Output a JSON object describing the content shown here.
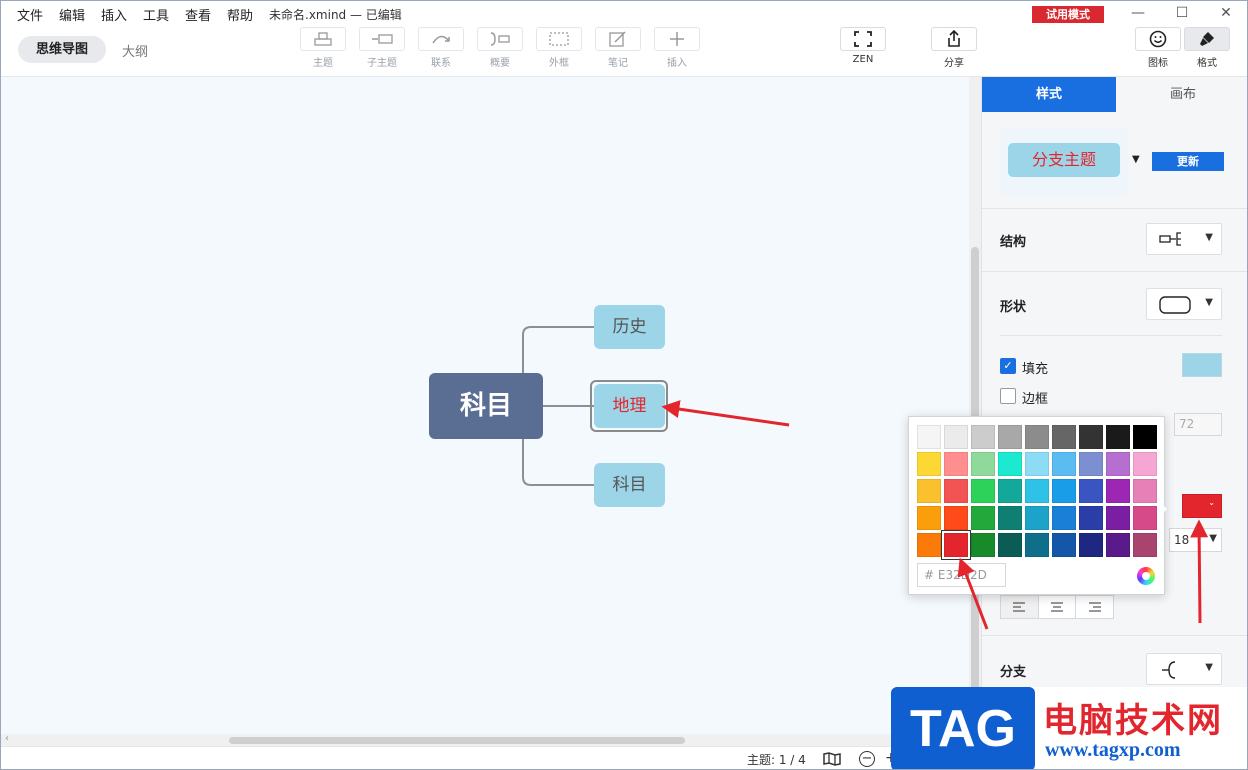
{
  "menu": [
    "文件",
    "编辑",
    "插入",
    "工具",
    "查看",
    "帮助"
  ],
  "document_title": "未命名.xmind — 已编辑",
  "trial_badge": "试用模式",
  "window_controls": {
    "minimize": "—",
    "maximize": "☐",
    "close": "✕"
  },
  "view_tabs": {
    "mindmap": "思维导图",
    "outline": "大纲"
  },
  "toolbar": {
    "topic": "主题",
    "subtopic": "子主题",
    "relationship": "联系",
    "summary": "概要",
    "boundary": "外框",
    "note": "笔记",
    "insert": "插入",
    "zen": "ZEN",
    "share": "分享",
    "icon": "图标",
    "format": "格式"
  },
  "mindmap": {
    "root": "科目",
    "children": [
      {
        "label": "历史",
        "selected": false
      },
      {
        "label": "地理",
        "selected": true
      },
      {
        "label": "科目",
        "selected": false
      }
    ]
  },
  "status": {
    "topic_count": "主题: 1 / 4",
    "zoom_minus": "−",
    "zoom_plus": "+"
  },
  "panel": {
    "tabs": {
      "style": "样式",
      "canvas": "画布"
    },
    "preview_label": "分支主题",
    "update_button": "更新",
    "structure_label": "结构",
    "shape_label": "形状",
    "fill_label": "填充",
    "fill_checked": true,
    "fill_color": "#9cd4e8",
    "border_label": "边框",
    "border_checked": false,
    "opacity_value": "72",
    "text_color": "#e3262d",
    "font_size": "18",
    "branch_label": "分支"
  },
  "palette": {
    "rows": [
      [
        "#f5f5f5",
        "#ebebeb",
        "#cccccc",
        "#a8a8a8",
        "#8c8c8c",
        "#666666",
        "#333333",
        "#1a1a1a",
        "#000000"
      ],
      [
        "#fdd835",
        "#ff8f8f",
        "#8fd99a",
        "#1de9d1",
        "#8ddcf5",
        "#5bbcf2",
        "#7b8fd1",
        "#b66fd0",
        "#f5a6d2"
      ],
      [
        "#fbc02d",
        "#f25454",
        "#2dd25a",
        "#14a89a",
        "#2ec2e6",
        "#1a9de8",
        "#3a55c2",
        "#9b27b4",
        "#e880b8"
      ],
      [
        "#fb9e0c",
        "#ff4a1a",
        "#22a83b",
        "#0f7f74",
        "#1ca3c9",
        "#1a7fd6",
        "#2b3da6",
        "#7b1fa2",
        "#d64a8a"
      ],
      [
        "#fb7b0a",
        "#e3262d",
        "#178a2a",
        "#0b5c57",
        "#0f6f8a",
        "#1457a8",
        "#1e2880",
        "#5a1a8a",
        "#a8446e"
      ]
    ],
    "selected": [
      4,
      1
    ],
    "hex_prefix": "#",
    "hex_value": "E32D2D"
  },
  "watermark": {
    "tag": "TAG",
    "title": "电脑技术网",
    "url": "www.tagxp.com"
  }
}
